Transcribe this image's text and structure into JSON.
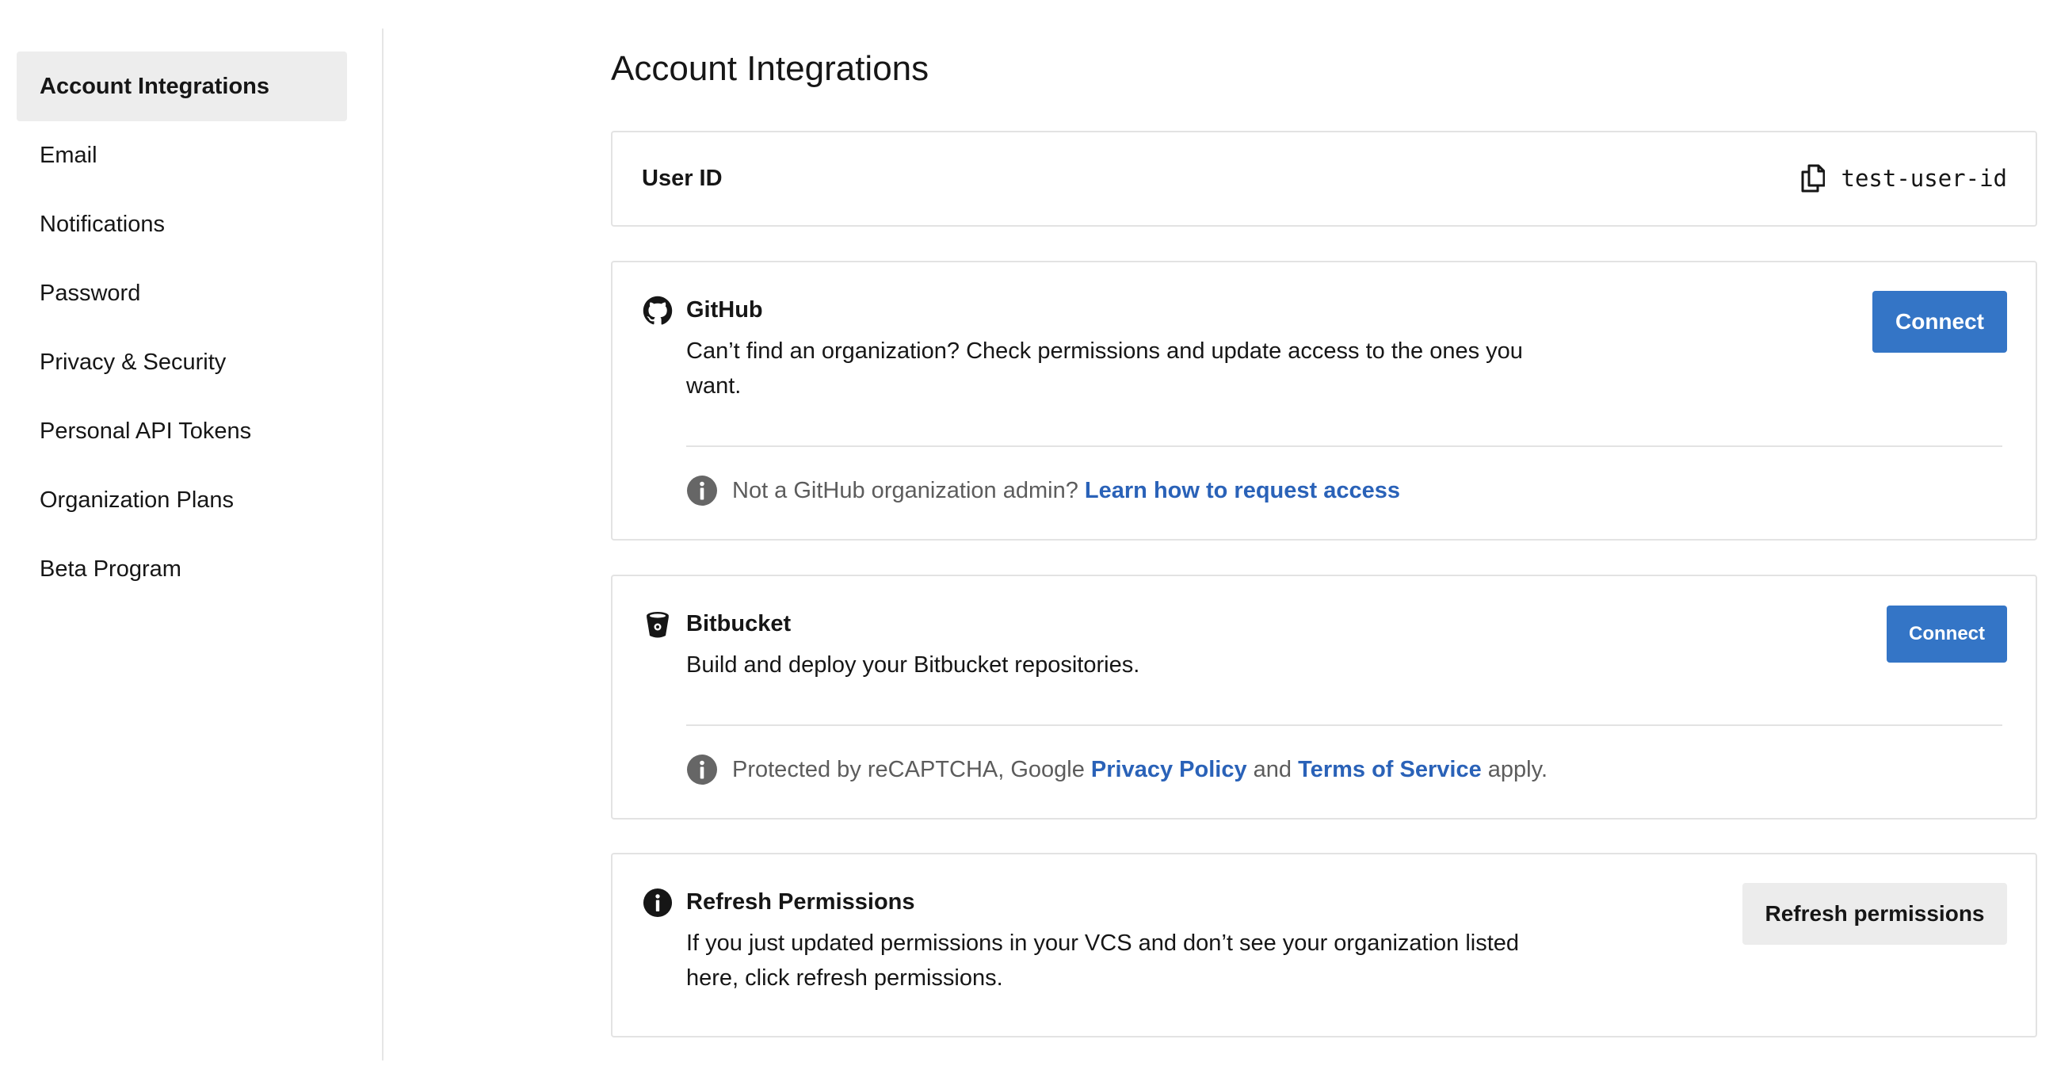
{
  "sidebar": {
    "items": [
      {
        "label": "Account Integrations",
        "active": true
      },
      {
        "label": "Email"
      },
      {
        "label": "Notifications"
      },
      {
        "label": "Password"
      },
      {
        "label": "Privacy & Security"
      },
      {
        "label": "Personal API Tokens"
      },
      {
        "label": "Organization Plans"
      },
      {
        "label": "Beta Program"
      }
    ]
  },
  "main": {
    "title": "Account Integrations",
    "user_id": {
      "label": "User ID",
      "value": "test-user-id",
      "icon": "copy-icon"
    },
    "github": {
      "icon": "github-icon",
      "title": "GitHub",
      "description": "Can’t find an organization? Check permissions and update access to the ones you want.",
      "button": "Connect",
      "note_text": "Not a GitHub organization admin?",
      "note_link": "Learn how to request access"
    },
    "bitbucket": {
      "icon": "bitbucket-icon",
      "title": "Bitbucket",
      "description": "Build and deploy your Bitbucket repositories.",
      "button": "Connect",
      "note_prefix": "Protected by reCAPTCHA, Google",
      "privacy_link": "Privacy Policy",
      "note_and": "and",
      "terms_link": "Terms of Service",
      "note_suffix": "apply."
    },
    "refresh": {
      "icon": "info-icon",
      "title": "Refresh Permissions",
      "description": "If you just updated permissions in your VCS and don’t see your organization listed here, click refresh permissions.",
      "button": "Refresh permissions"
    }
  },
  "colors": {
    "primary_button": "#3475c6",
    "link": "#2a62b8",
    "active_nav_bg": "#ededed",
    "border": "#e3e3e3"
  }
}
